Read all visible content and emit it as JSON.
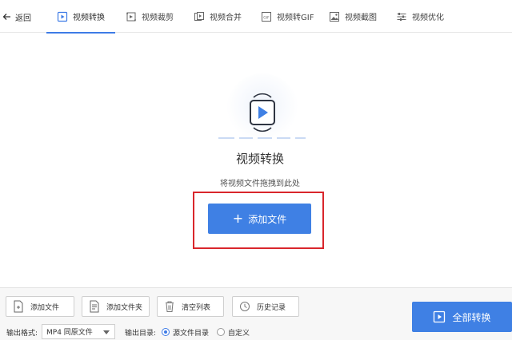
{
  "nav": {
    "back_label": "返回",
    "tabs": [
      {
        "label": "视频转换",
        "icon": "video-convert-icon",
        "active": true
      },
      {
        "label": "视频裁剪",
        "icon": "video-crop-icon",
        "active": false
      },
      {
        "label": "视频合并",
        "icon": "video-merge-icon",
        "active": false
      },
      {
        "label": "视频转GIF",
        "icon": "gif-icon",
        "active": false
      },
      {
        "label": "视频截图",
        "icon": "screenshot-icon",
        "active": false
      },
      {
        "label": "视频优化",
        "icon": "sliders-icon",
        "active": false
      }
    ]
  },
  "main": {
    "title": "视频转换",
    "hint": "将视频文件拖拽到此处",
    "add_button_label": "添加文件",
    "accent_color": "#3f80e4",
    "highlight_color": "#d9262c"
  },
  "toolbar": {
    "add_file_label": "添加文件",
    "add_folder_label": "添加文件夹",
    "clear_list_label": "清空列表",
    "history_label": "历史记录"
  },
  "options": {
    "format_label": "输出格式:",
    "format_value": "MP4 同原文件",
    "dir_label": "输出目录:",
    "dir_options": [
      {
        "label": "源文件目录",
        "selected": true
      },
      {
        "label": "自定义",
        "selected": false
      }
    ]
  },
  "convert_all_label": "全部转换"
}
